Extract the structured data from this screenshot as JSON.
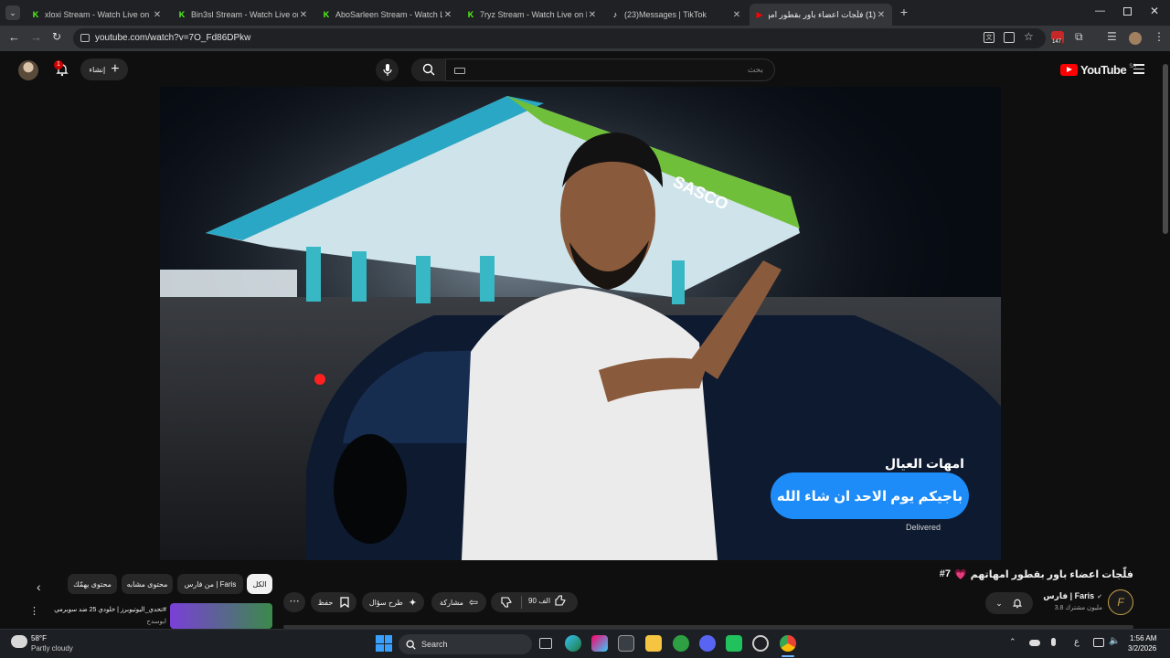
{
  "browser": {
    "tabs": [
      {
        "label": "xloxi Stream - Watch Live on Kick",
        "icon": "kick-icon",
        "color": "#53fc18",
        "glyph": "K"
      },
      {
        "label": "Bin3sl Stream - Watch Live on Kick",
        "icon": "kick-icon",
        "color": "#53fc18",
        "glyph": "K"
      },
      {
        "label": "AboSarleen Stream - Watch Live on Kick",
        "icon": "kick-icon",
        "color": "#53fc18",
        "glyph": "K"
      },
      {
        "label": "7ryz Stream - Watch Live on Kick",
        "icon": "kick-icon",
        "color": "#53fc18",
        "glyph": "K"
      },
      {
        "label": "(23)Messages | TikTok",
        "icon": "tiktok-icon",
        "color": "#ffffff",
        "glyph": "♪"
      },
      {
        "label": "(1) فلّجات اعضاء باور بقطور امهاتهم",
        "icon": "youtube-icon",
        "color": "#ff0000",
        "glyph": "▶"
      }
    ],
    "url": "youtube.com/watch?v=7O_Fd86DPkw",
    "ext_badge": "147"
  },
  "youtube": {
    "logo": "YouTube",
    "region": "SA",
    "search_placeholder": "بحث",
    "create_label": "إنشاء",
    "notif_count": "1"
  },
  "video": {
    "sign_text": "SASCO",
    "chat_sender": "امهات العيال",
    "chat_message": "باجيكم يوم الاحد ان شاء الله",
    "chat_status": "Delivered"
  },
  "watch": {
    "title": "فلّجات اعضاء باور بقطور امهاتهم",
    "title_emoji": "💗",
    "title_tag": "#7",
    "channel_name": "فارس | Faris",
    "subscribers": "3.8 مليون مشترك",
    "likes": "90 الف",
    "share_label": "مشاركة",
    "ask_label": "طرح سؤال",
    "save_label": "حفظ",
    "chips": [
      "الكل",
      "من فارس | Faris",
      "محتوى مشابه",
      "محتوى يهمّك"
    ],
    "rec_title": "#تحدي_اليوتيوبرز | خلودي 25 ضد سوبرمي",
    "rec_subtitle": "ابوسدح"
  },
  "taskbar": {
    "weather_temp": "58°F",
    "weather_desc": "Partly cloudy",
    "search_label": "Search",
    "lang": "ع",
    "time": "1:56 AM",
    "date": "3/2/2026"
  }
}
